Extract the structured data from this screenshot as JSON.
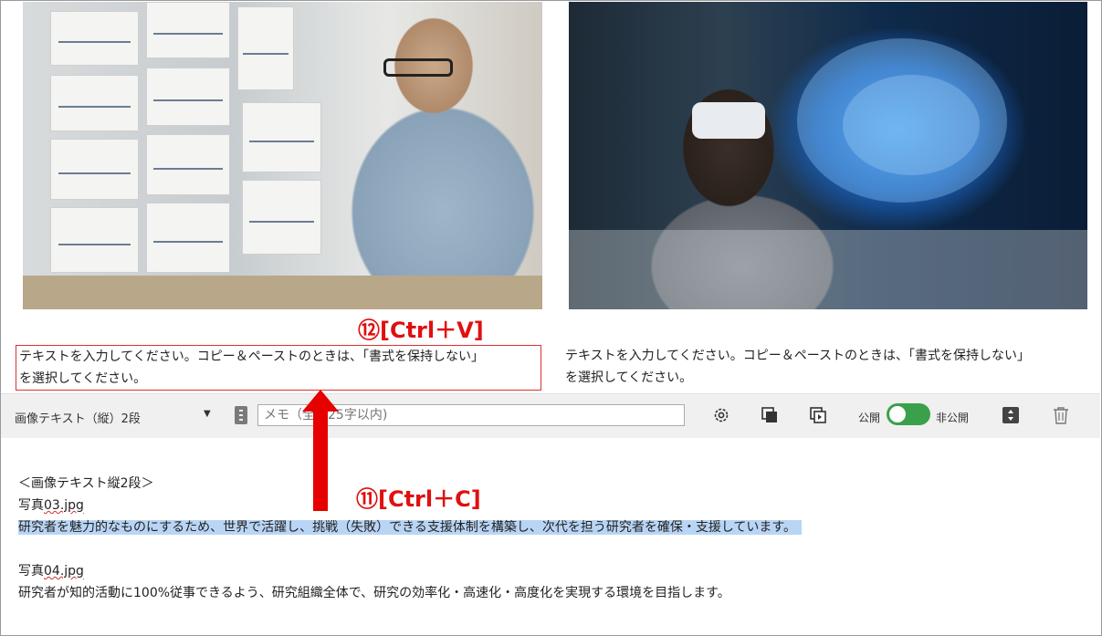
{
  "photos": {
    "left_alt": "researcher photo",
    "right_alt": "vr brain photo"
  },
  "blocks": {
    "left": {
      "line1": "テキストを入力してください。コピー＆ペーストのときは、「書式を保持しない」",
      "line2": "を選択してください。"
    },
    "right": {
      "line1": "テキストを入力してください。コピー＆ペーストのときは、「書式を保持しない」",
      "line2": "を選択してください。"
    }
  },
  "annotations": {
    "step12": "⑫[Ctrl＋V]",
    "step11": "⑪[Ctrl＋C]",
    "color": "#e01010"
  },
  "toolbar": {
    "block_type": "画像テキスト（縦）2段",
    "memo_placeholder": "メモ（全角25字以内)",
    "public_label": "公開",
    "private_label": "非公開",
    "toggle_color": "#3aa14a"
  },
  "editor": {
    "lines": [
      "＜画像テキスト縦2段＞",
      "写真03.jpg",
      "研究者を魅力的なものにするため、世界で活躍し、挑戦（失敗）できる支援体制を構築し、次代を担う研究者を確保・支援しています。",
      "",
      "写真04.jpg",
      "研究者が知的活動に100%従事できるよう、研究組織全体で、研究の効率化・高速化・高度化を実現する環境を目指します。"
    ],
    "photo03_prefix": "写真",
    "photo03_name": "03.jpg",
    "photo04_prefix": "写真",
    "photo04_name": "04.jpg",
    "highlight_color": "#b9d5f5"
  }
}
